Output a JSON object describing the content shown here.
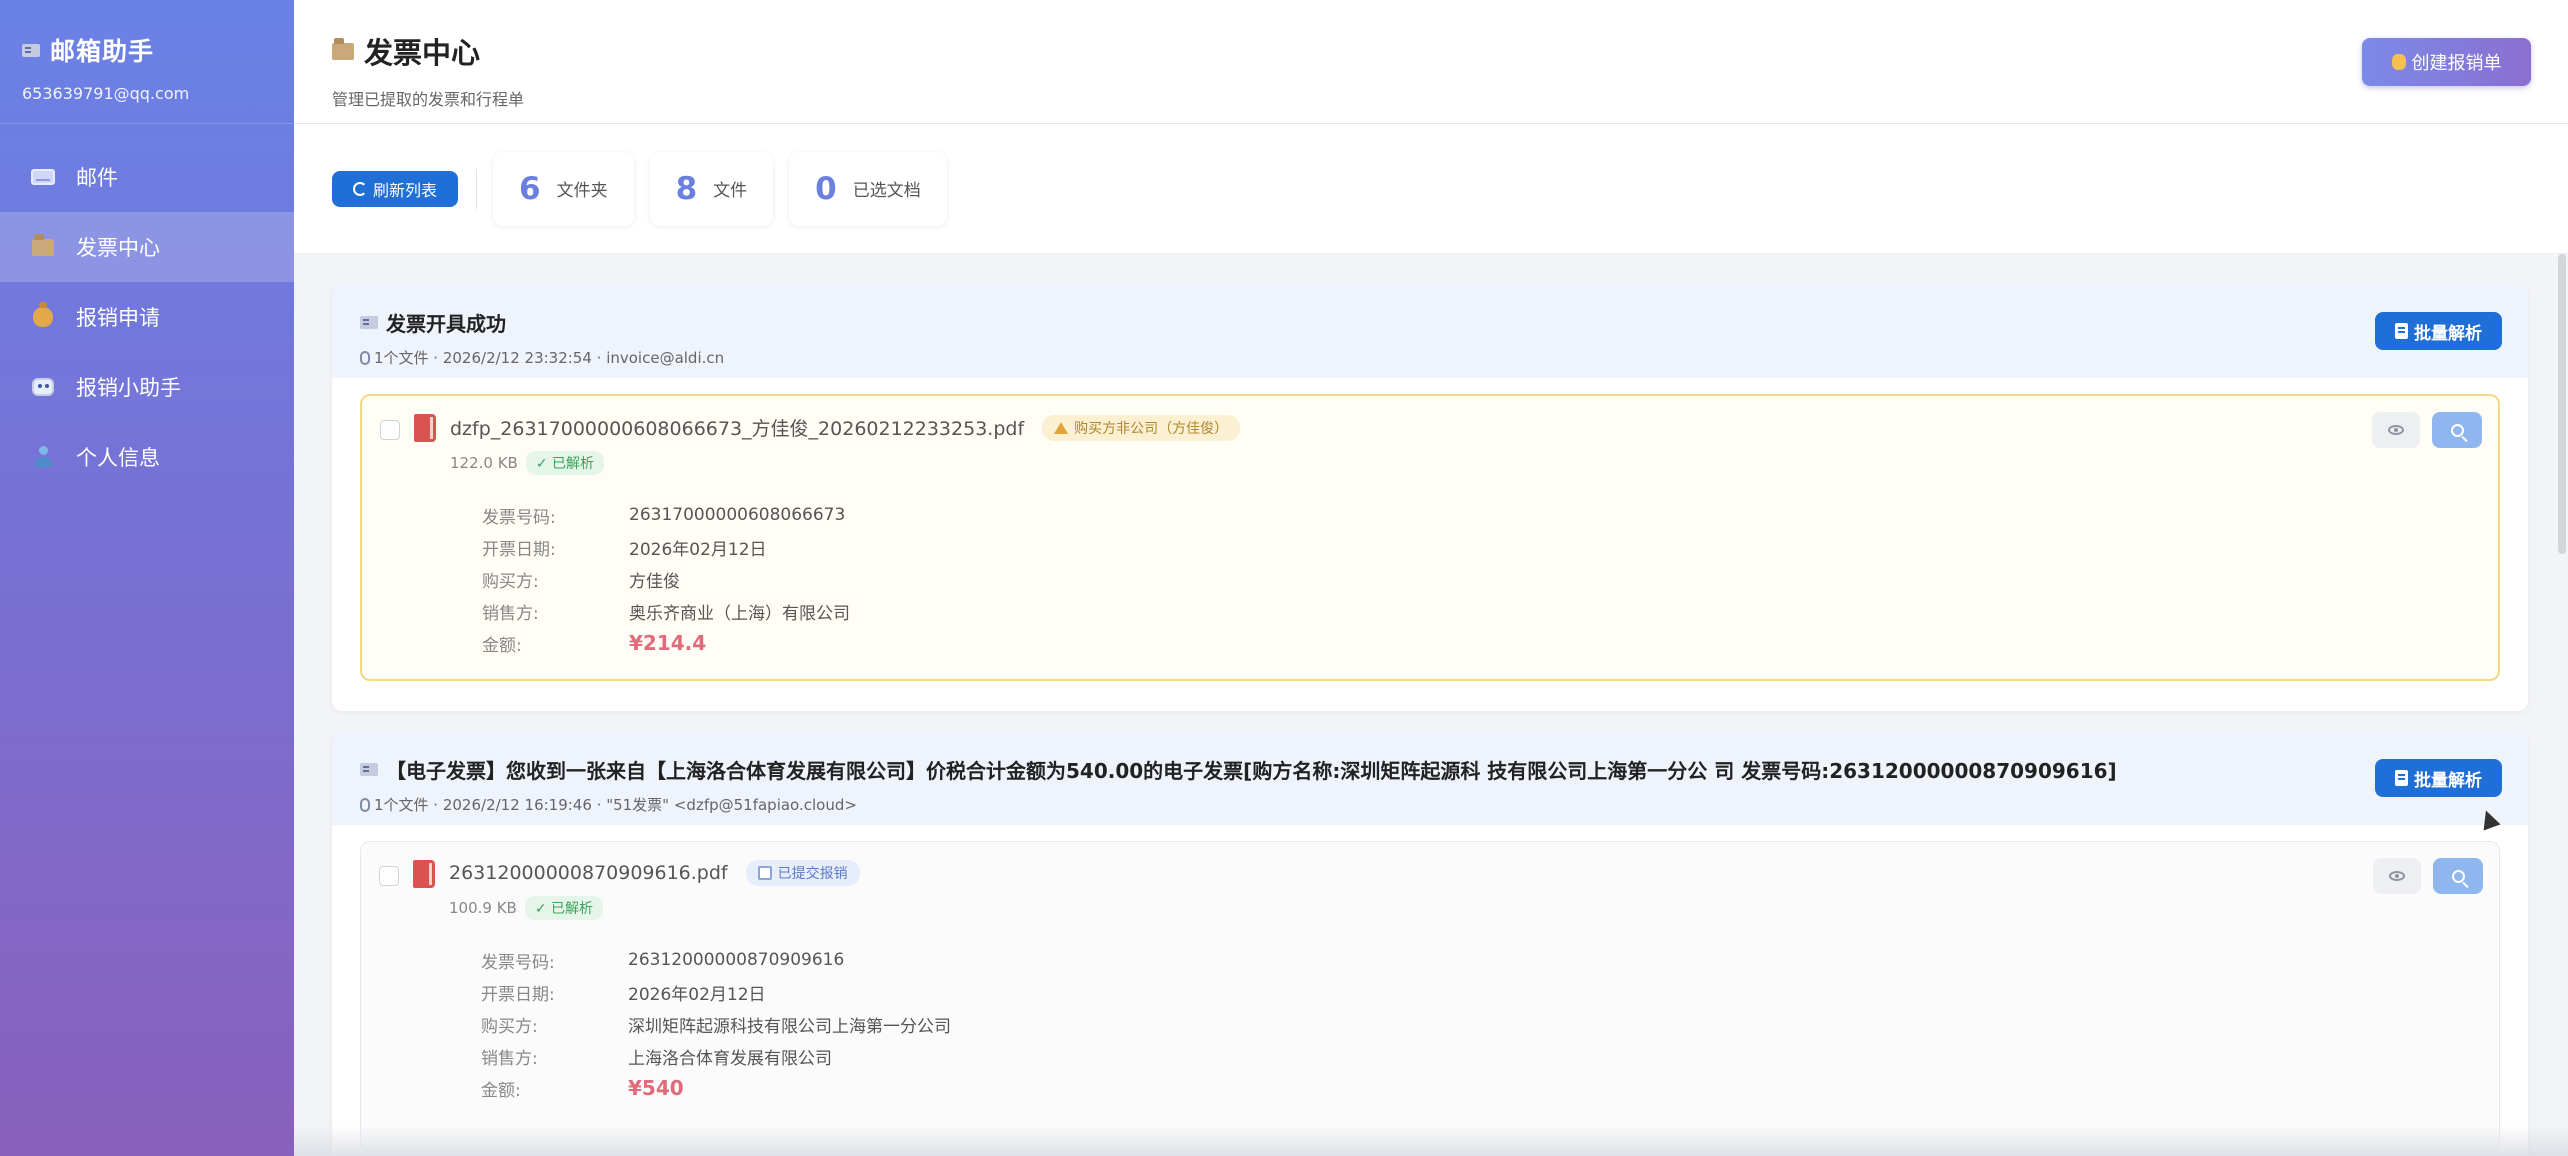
{
  "sidebar": {
    "title": "邮箱助手",
    "email": "653639791@qq.com",
    "items": [
      {
        "label": "邮件",
        "icon": "mail-icon"
      },
      {
        "label": "发票中心",
        "icon": "folder-icon",
        "active": true
      },
      {
        "label": "报销申请",
        "icon": "money-bag-icon"
      },
      {
        "label": "报销小助手",
        "icon": "robot-icon"
      },
      {
        "label": "个人信息",
        "icon": "user-icon"
      }
    ]
  },
  "header": {
    "title": "发票中心",
    "subtitle": "管理已提取的发票和行程单",
    "create_label": "创建报销单"
  },
  "toolbar": {
    "refresh_label": "刷新列表",
    "stats": [
      {
        "value": "6",
        "label": "文件夹"
      },
      {
        "value": "8",
        "label": "文件"
      },
      {
        "value": "0",
        "label": "已选文档"
      }
    ]
  },
  "groups": [
    {
      "title": "发票开具成功",
      "meta": "1个文件 · 2026/2/12 23:32:54 · invoice@aldi.cn",
      "batch_label": "批量解析",
      "file": {
        "name": "dzfp_26317000000608066673_方佳俊_20260212233253.pdf",
        "tag": "购买方非公司（方佳俊）",
        "size": "122.0 KB",
        "status": "✓ 已解析"
      },
      "fields": [
        {
          "label": "发票号码:",
          "value": "26317000000608066673"
        },
        {
          "label": "开票日期:",
          "value": "2026年02月12日"
        },
        {
          "label": "购买方:",
          "value": "方佳俊"
        },
        {
          "label": "销售方:",
          "value": "奥乐齐商业（上海）有限公司"
        },
        {
          "label": "金额:",
          "value": "¥214.4"
        }
      ]
    },
    {
      "title": "【电子发票】您收到一张来自【上海洛合体育发展有限公司】价税合计金额为540.00的电子发票[购方名称:深圳矩阵起源科 技有限公司上海第一分公 司 发票号码:26312000000870909616]",
      "meta": "1个文件 · 2026/2/12 16:19:46 · \"51发票\" <dzfp@51fapiao.cloud>",
      "batch_label": "批量解析",
      "file": {
        "name": "26312000000870909616.pdf",
        "tag": "已提交报销",
        "size": "100.9 KB",
        "status": "✓ 已解析"
      },
      "fields": [
        {
          "label": "发票号码:",
          "value": "26312000000870909616"
        },
        {
          "label": "开票日期:",
          "value": "2026年02月12日"
        },
        {
          "label": "购买方:",
          "value": "深圳矩阵起源科技有限公司上海第一分公司"
        },
        {
          "label": "销售方:",
          "value": "上海洛合体育发展有限公司"
        },
        {
          "label": "金额:",
          "value": "¥540"
        }
      ]
    }
  ],
  "colors": {
    "sidebar_top": "#6a82e6",
    "sidebar_bottom": "#8a60bd",
    "primary": "#1f6fd6",
    "stat_number": "#6a7fe0",
    "amount": "#e06b7a"
  }
}
